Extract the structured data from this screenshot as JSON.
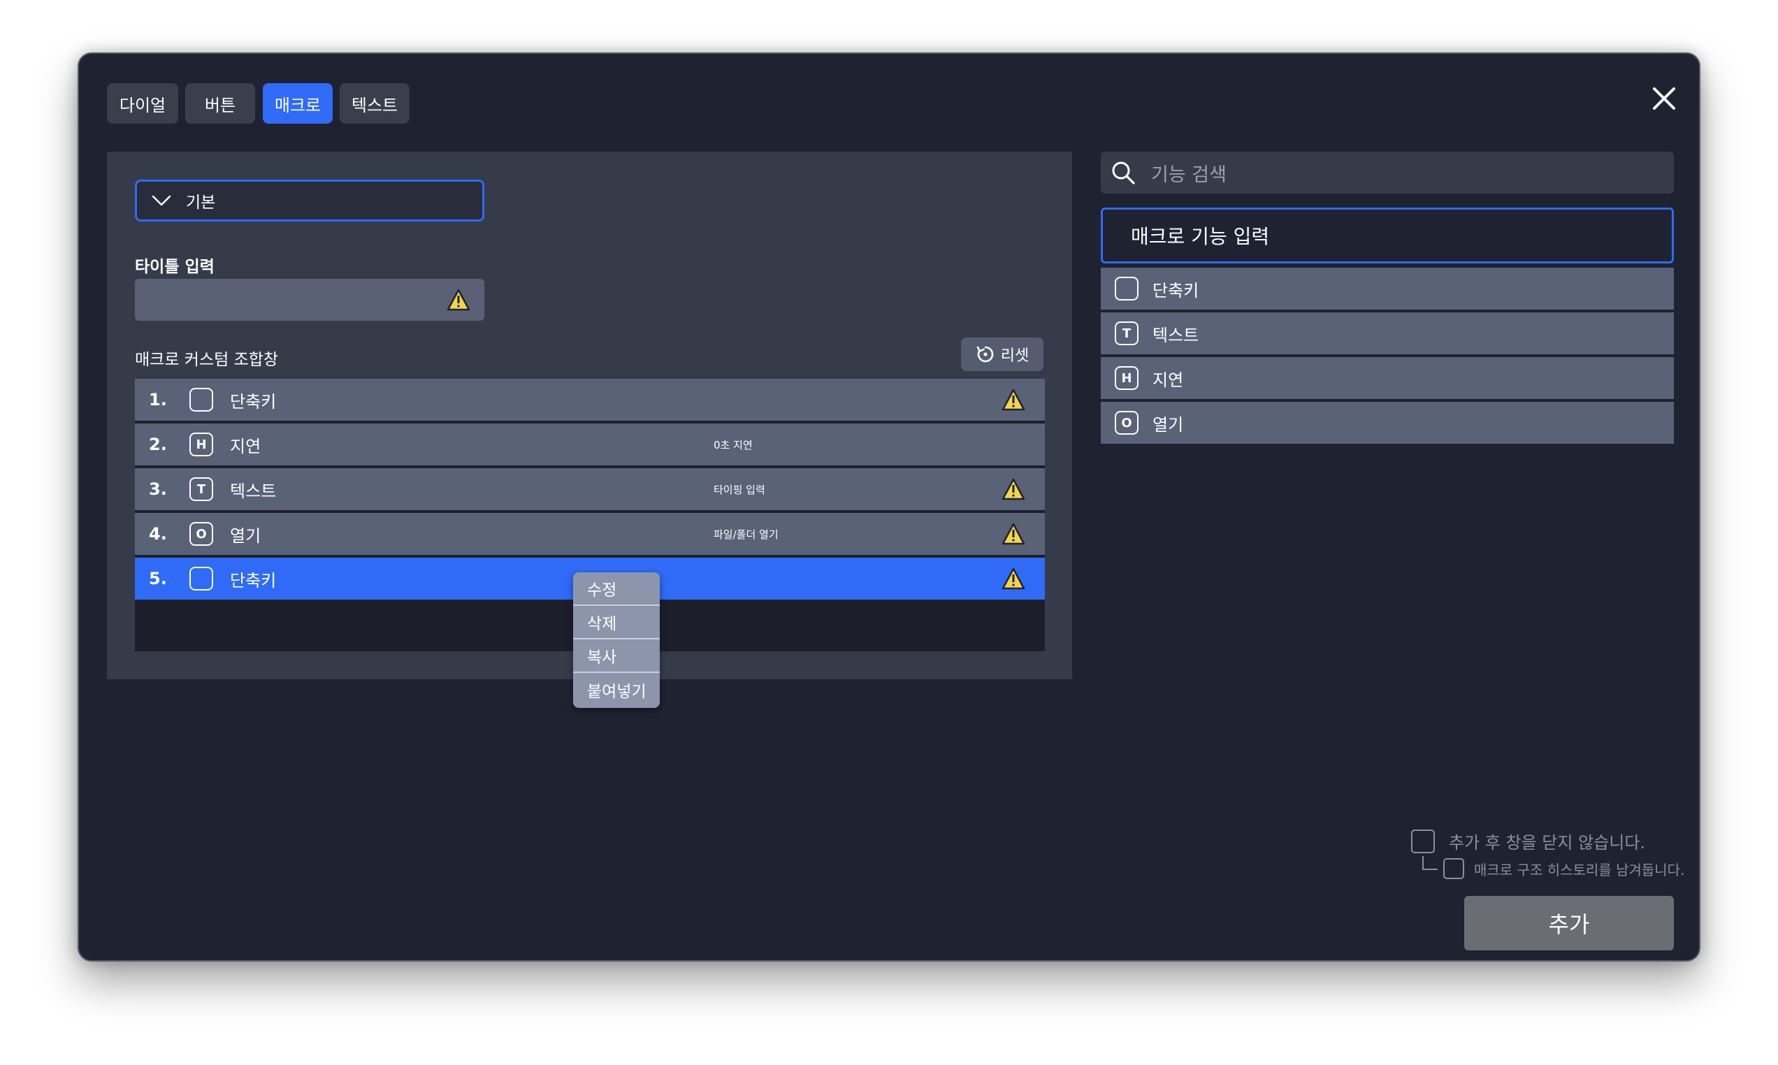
{
  "tabs": [
    {
      "label": "다이얼",
      "active": false
    },
    {
      "label": "버튼",
      "active": false
    },
    {
      "label": "매크로",
      "active": true
    },
    {
      "label": "텍스트",
      "active": false
    }
  ],
  "editor": {
    "preset_dropdown": "기본",
    "title_label": "타이틀 입력",
    "title_value": "",
    "combo_label": "매크로 커스텀 조합창",
    "reset_label": "리셋",
    "steps": [
      {
        "num": "1.",
        "icon_letter": "",
        "name": "단축키",
        "detail": "",
        "warning": true,
        "selected": false
      },
      {
        "num": "2.",
        "icon_letter": "H",
        "name": "지연",
        "detail": "0초 지연",
        "warning": false,
        "selected": false
      },
      {
        "num": "3.",
        "icon_letter": "T",
        "name": "텍스트",
        "detail": "타이핑 입력",
        "warning": true,
        "selected": false
      },
      {
        "num": "4.",
        "icon_letter": "O",
        "name": "열기",
        "detail": "파일/폴더 열기",
        "warning": true,
        "selected": false
      },
      {
        "num": "5.",
        "icon_letter": "",
        "name": "단축키",
        "detail": "",
        "warning": true,
        "selected": true
      }
    ]
  },
  "context_menu": {
    "items": [
      "수정",
      "삭제",
      "복사",
      "붙여넣기"
    ]
  },
  "function_panel": {
    "search_placeholder": "기능 검색",
    "header": "매크로 기능 입력",
    "items": [
      {
        "icon_letter": "",
        "label": "단축키"
      },
      {
        "icon_letter": "T",
        "label": "텍스트"
      },
      {
        "icon_letter": "H",
        "label": "지연"
      },
      {
        "icon_letter": "O",
        "label": "열기"
      }
    ]
  },
  "options": {
    "keep_open": "추가 후 창을 닫지 않습니다.",
    "keep_history": "매크로 구조 히스토리를 남겨둡니다."
  },
  "add_button": "추가",
  "colors": {
    "accent": "#2f6bf6",
    "warning": "#f5d547",
    "dialog_bg": "#1f2230",
    "row_bg": "#5a6278"
  }
}
